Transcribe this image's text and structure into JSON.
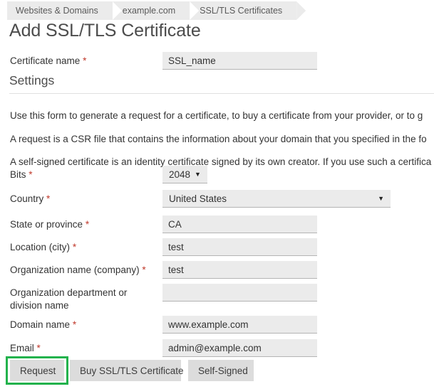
{
  "breadcrumb": {
    "items": [
      {
        "label": "Websites & Domains"
      },
      {
        "label": "example.com"
      },
      {
        "label": "SSL/TLS Certificates"
      }
    ]
  },
  "page": {
    "title": "Add SSL/TLS Certificate",
    "section_heading": "Settings"
  },
  "certificate_name": {
    "label": "Certificate name",
    "required_marker": "*",
    "value": "SSL_name",
    "placeholder": ""
  },
  "descriptions": [
    "Use this form to generate a request for a certificate, to buy a certificate from your provider, or to g",
    "A request is a CSR file that contains the information about your domain that you specified in the fo",
    "A self-signed certificate is an identity certificate signed by its own creator. If you use such a certifica"
  ],
  "fields": [
    {
      "name": "bits",
      "label": "Bits",
      "required_marker": "*",
      "type": "select",
      "value": "2048",
      "caret": "▼"
    },
    {
      "name": "country",
      "label": "Country",
      "required_marker": "*",
      "type": "select",
      "value": "United States",
      "caret": "▼"
    },
    {
      "name": "state",
      "label": "State or province",
      "required_marker": "*",
      "type": "text",
      "value": "CA",
      "placeholder": ""
    },
    {
      "name": "city",
      "label": "Location (city)",
      "required_marker": "*",
      "type": "text",
      "value": "test",
      "placeholder": ""
    },
    {
      "name": "organization",
      "label": "Organization name (company)",
      "required_marker": "*",
      "type": "text",
      "value": "test",
      "placeholder": ""
    },
    {
      "name": "department",
      "label": "Organization department or division name",
      "required_marker": "",
      "type": "text",
      "value": "",
      "placeholder": ""
    },
    {
      "name": "domain",
      "label": "Domain name",
      "required_marker": "*",
      "type": "text",
      "value": "www.example.com",
      "placeholder": ""
    },
    {
      "name": "email",
      "label": "Email",
      "required_marker": "*",
      "type": "text",
      "value": "admin@example.com",
      "placeholder": ""
    }
  ],
  "buttons": {
    "request": "Request",
    "buy": "Buy SSL/TLS Certificate",
    "self_signed": "Self-Signed"
  },
  "colors": {
    "highlight": "#22b24c",
    "required": "#c0392b",
    "input_bg": "#ebebeb",
    "button_bg": "#dcdcdc",
    "breadcrumb_bg": "#ebebeb"
  }
}
